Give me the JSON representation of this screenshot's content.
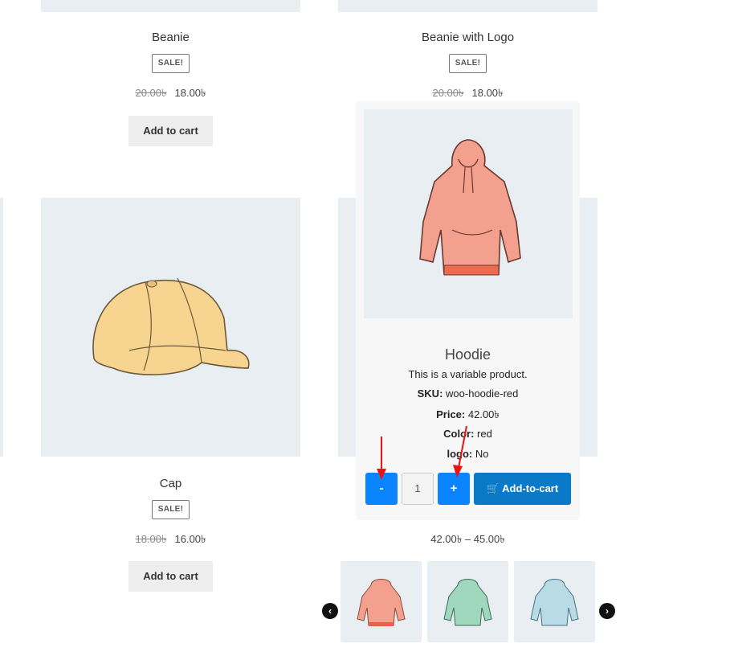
{
  "products": {
    "beanie": {
      "title": "Beanie",
      "badge": "SALE!",
      "old_price": "20.00৳",
      "price": "18.00৳",
      "cart": "Add to cart"
    },
    "beanie_logo": {
      "title": "Beanie with Logo",
      "badge": "SALE!",
      "old_price": "20.00৳",
      "price": "18.00৳"
    },
    "cap": {
      "title": "Cap",
      "badge": "SALE!",
      "old_price": "18.00৳",
      "price": "16.00৳",
      "cart": "Add to cart"
    },
    "hoodie_range": {
      "from": "42.00৳",
      "sep": "–",
      "to": "45.00৳"
    }
  },
  "popup": {
    "close": "×",
    "name": "Hoodie",
    "description": "This is a variable product.",
    "sku_label": "SKU:",
    "sku": "woo-hoodie-red",
    "price_label": "Price:",
    "price": "42.00৳",
    "color_label": "Color:",
    "color": "red",
    "logo_label": "logo:",
    "logo": "No",
    "minus": "-",
    "qty": "1",
    "plus": "+",
    "add_to_cart": "Add-to-cart"
  },
  "thumbnails": [
    {
      "name": "hoodie-red",
      "color": "#f3a08f"
    },
    {
      "name": "hoodie-green",
      "color": "#9fd8bd"
    },
    {
      "name": "hoodie-blue",
      "color": "#b9dbe6"
    }
  ],
  "colors": {
    "accent": "#0a84ff",
    "cart_button": "#0a7ac8",
    "image_bg": "#e9eef2",
    "annotation_arrow": "#ee1111"
  }
}
